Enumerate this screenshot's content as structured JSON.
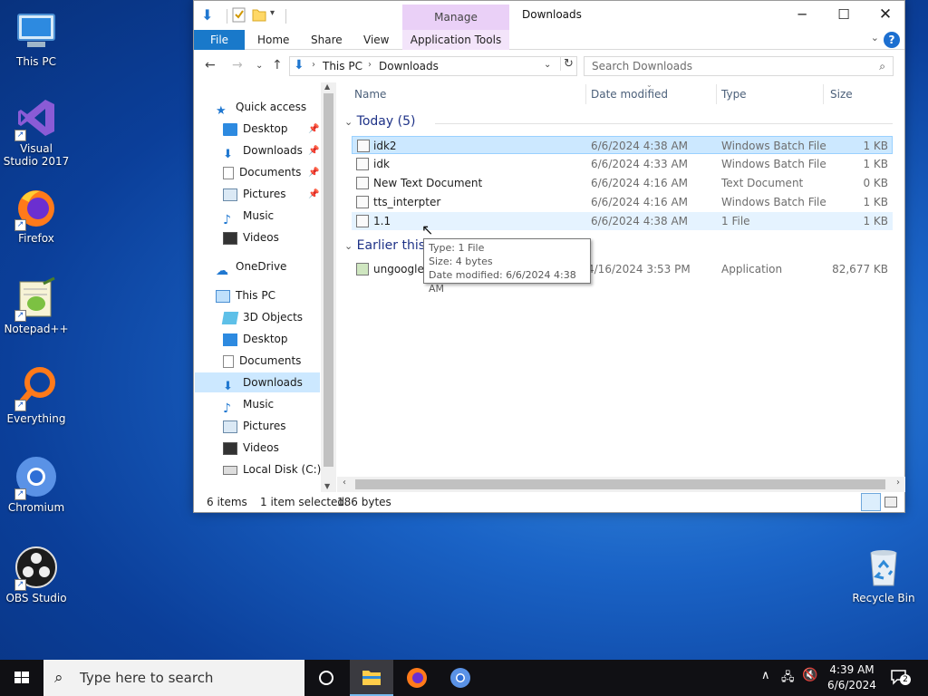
{
  "desktop": {
    "icons": [
      {
        "label": "This PC",
        "icon": "monitor-icon"
      },
      {
        "label": "Visual Studio 2017",
        "icon": "visual-studio-icon"
      },
      {
        "label": "Firefox",
        "icon": "firefox-icon"
      },
      {
        "label": "Notepad++",
        "icon": "notepadpp-icon"
      },
      {
        "label": "Everything",
        "icon": "magnifier-icon"
      },
      {
        "label": "Chromium",
        "icon": "chromium-icon"
      },
      {
        "label": "OBS Studio",
        "icon": "obs-icon"
      },
      {
        "label": "Recycle Bin",
        "icon": "recycle-bin-icon"
      }
    ]
  },
  "window": {
    "title": "Downloads",
    "contextual_group": "Manage",
    "tabs": [
      "File",
      "Home",
      "Share",
      "View",
      "Application Tools"
    ],
    "address": {
      "segments": [
        "This PC",
        "Downloads"
      ]
    },
    "search_placeholder": "Search Downloads",
    "nav": {
      "quick_access": "Quick access",
      "quick_items": [
        "Desktop",
        "Downloads",
        "Documents",
        "Pictures",
        "Music",
        "Videos"
      ],
      "onedrive": "OneDrive",
      "this_pc": "This PC",
      "pc_items": [
        "3D Objects",
        "Desktop",
        "Documents",
        "Downloads",
        "Music",
        "Pictures",
        "Videos",
        "Local Disk (C:)"
      ],
      "selected": "Downloads"
    },
    "columns": [
      "Name",
      "Date modified",
      "Type",
      "Size"
    ],
    "groups": [
      {
        "label": "Today (5)",
        "files": [
          {
            "name": "idk2",
            "date": "6/6/2024 4:38 AM",
            "type": "Windows Batch File",
            "size": "1 KB"
          },
          {
            "name": "idk",
            "date": "6/6/2024 4:33 AM",
            "type": "Windows Batch File",
            "size": "1 KB"
          },
          {
            "name": "New Text Document",
            "date": "6/6/2024 4:16 AM",
            "type": "Text Document",
            "size": "0 KB"
          },
          {
            "name": "tts_interpter",
            "date": "6/6/2024 4:16 AM",
            "type": "Windows Batch File",
            "size": "1 KB"
          },
          {
            "name": "1.1",
            "date": "6/6/2024 4:38 AM",
            "type": "1 File",
            "size": "1 KB"
          }
        ]
      },
      {
        "label": "Earlier this",
        "files": [
          {
            "name": "ungoogle",
            "date": "4/16/2024 3:53 PM",
            "type": "Application",
            "size": "82,677 KB"
          }
        ]
      }
    ],
    "tooltip": [
      "Type: 1 File",
      "Size: 4 bytes",
      "Date modified: 6/6/2024 4:38 AM"
    ],
    "status": {
      "items": "6 items",
      "selected": "1 item selected",
      "bytes": "186 bytes"
    }
  },
  "taskbar": {
    "search_placeholder": "Type here to search",
    "time": "4:39 AM",
    "date": "6/6/2024",
    "notification_count": "2"
  }
}
